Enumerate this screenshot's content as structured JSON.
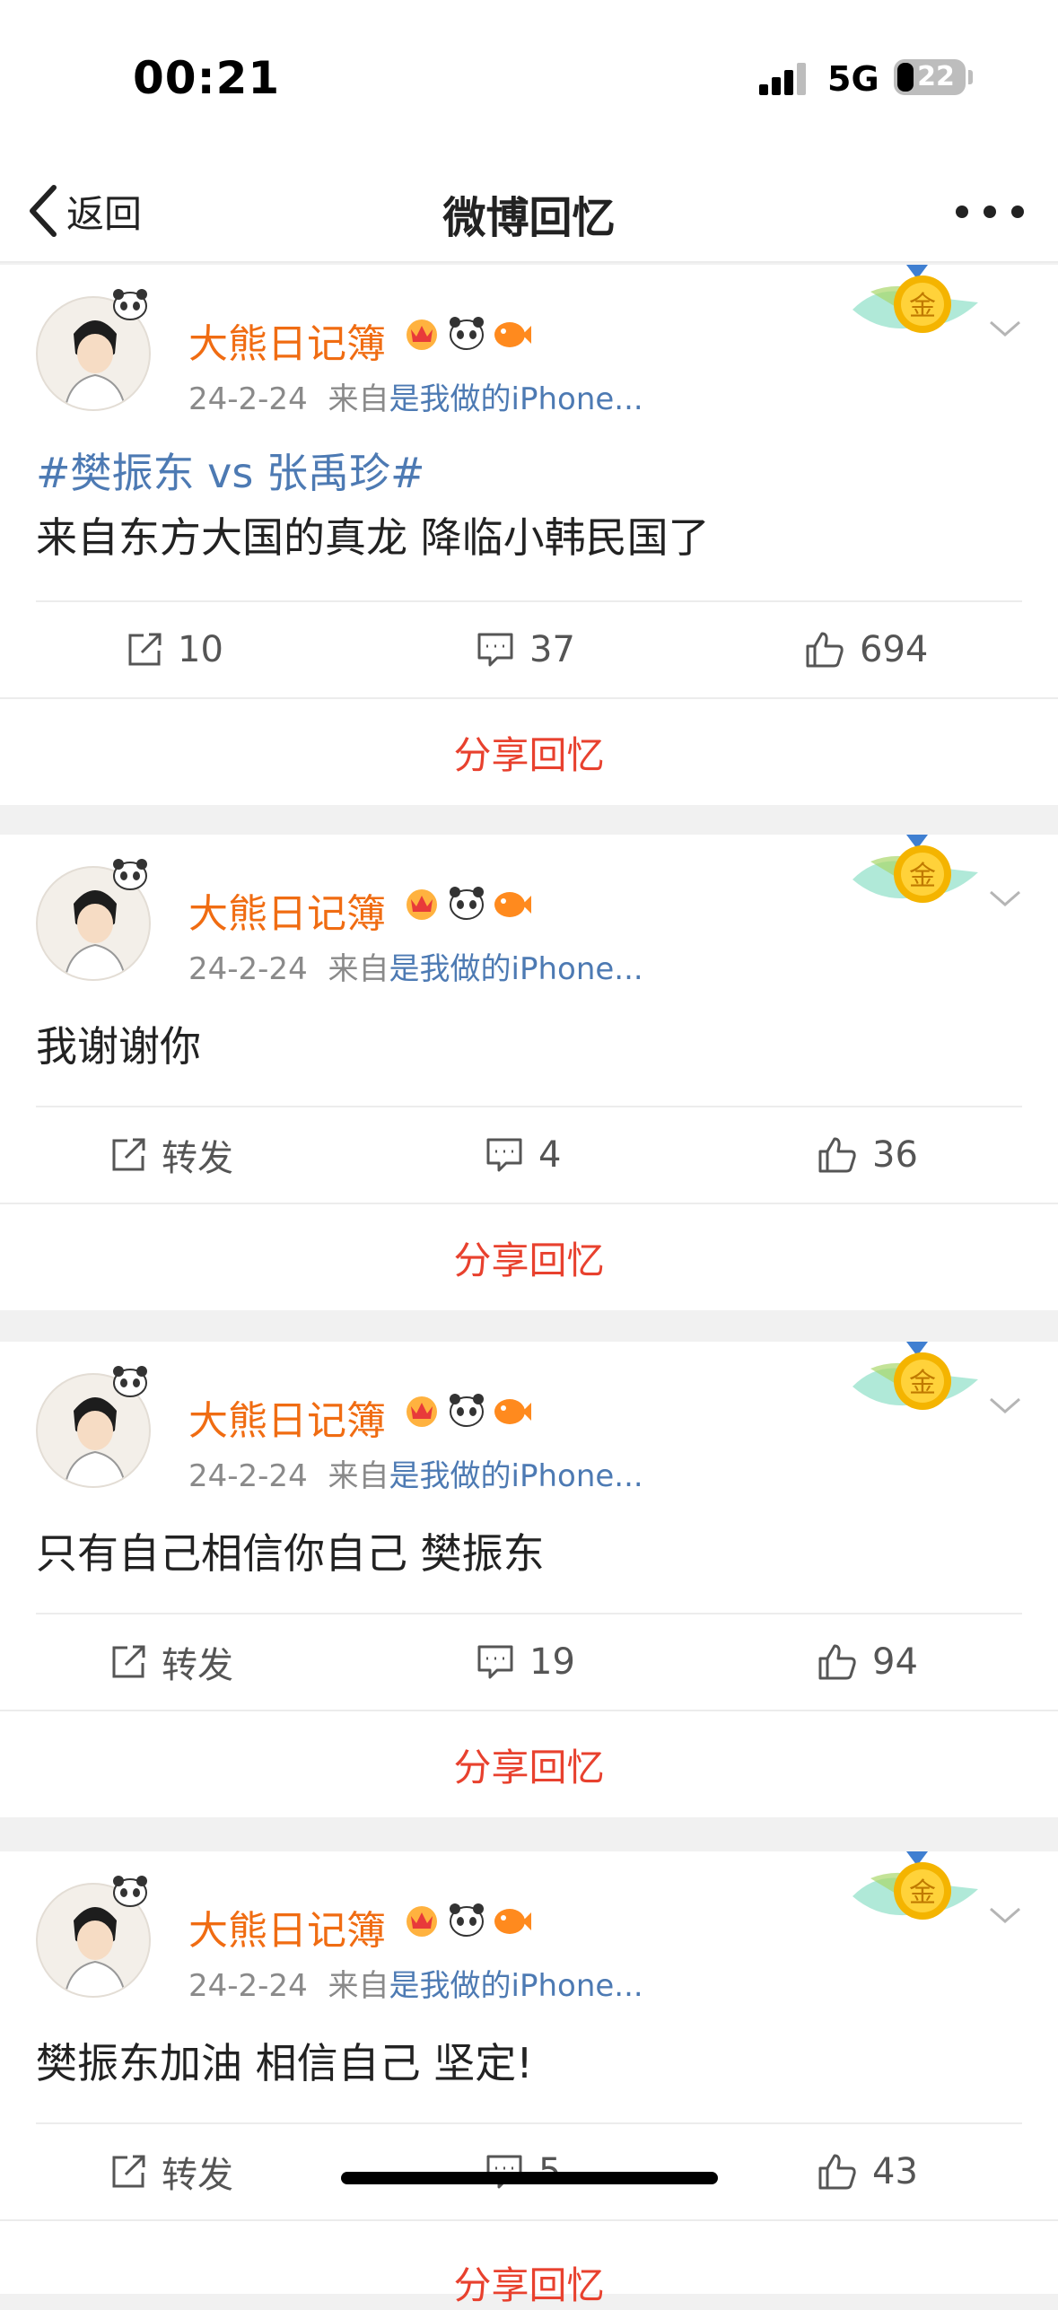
{
  "status_bar": {
    "time": "00:21",
    "network": "5G",
    "battery": "22"
  },
  "nav": {
    "back_label": "返回",
    "title": "微博回忆"
  },
  "posts": [
    {
      "username": "大熊日记簿",
      "date": "24-2-24",
      "source_prefix": "来自",
      "source": "是我做的iPhone...",
      "topic": "#樊振东 vs 张禹珍#",
      "text": "来自东方大国的真龙 降临小韩民国了",
      "repost": "10",
      "comments": "37",
      "likes": "694",
      "share_label": "分享回忆"
    },
    {
      "username": "大熊日记簿",
      "date": "24-2-24",
      "source_prefix": "来自",
      "source": "是我做的iPhone...",
      "text": "我谢谢你",
      "repost": "转发",
      "comments": "4",
      "likes": "36",
      "share_label": "分享回忆"
    },
    {
      "username": "大熊日记簿",
      "date": "24-2-24",
      "source_prefix": "来自",
      "source": "是我做的iPhone...",
      "text": "只有自己相信你自己 樊振东",
      "repost": "转发",
      "comments": "19",
      "likes": "94",
      "share_label": "分享回忆"
    },
    {
      "username": "大熊日记簿",
      "date": "24-2-24",
      "source_prefix": "来自",
      "source": "是我做的iPhone...",
      "text": "樊振东加油 相信自己  坚定!",
      "repost": "转发",
      "comments": "5",
      "likes": "43",
      "share_label": "分享回忆"
    }
  ],
  "medal_glyph": "金",
  "colors": {
    "username": "#f06c12",
    "link": "#4d7ab3",
    "share": "#e8412e",
    "medal": "#f4b400"
  },
  "icons": [
    "signal-icon",
    "battery-icon",
    "back-chevron-icon",
    "more-icon",
    "repost-icon",
    "comment-icon",
    "like-icon",
    "dropdown-icon",
    "medal-icon",
    "crown-badge-icon",
    "panda-badge-icon",
    "fish-badge-icon"
  ]
}
